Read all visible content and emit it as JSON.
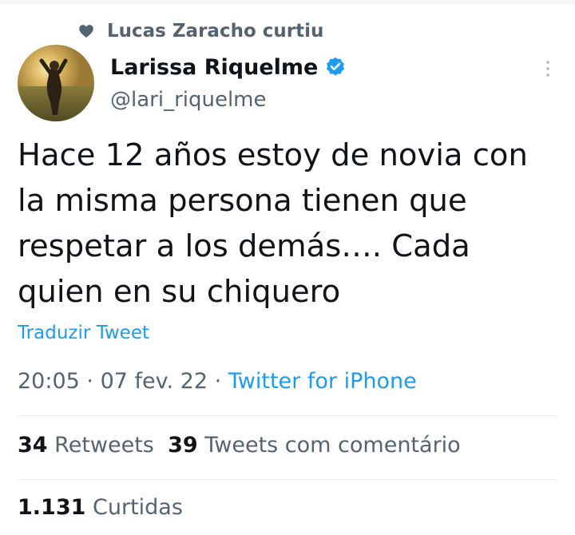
{
  "social_context": {
    "icon": "heart-icon",
    "text": "Lucas Zaracho curtiu"
  },
  "author": {
    "name": "Larissa Riquelme",
    "handle": "@lari_riquelme",
    "verified": true,
    "verified_color": "#1d9bf0"
  },
  "tweet": {
    "lines": [
      "Hace 12 años estoy de novia con",
      "la misma persona tienen que",
      "respetar a los demás…. Cada",
      "quien en su chiquero"
    ],
    "translate_label": "Traduzir Tweet"
  },
  "meta": {
    "time": "20:05",
    "separator": " · ",
    "date": "07 fev. 22",
    "source": "Twitter for iPhone"
  },
  "stats": {
    "retweets_count": "34",
    "retweets_label": "Retweets",
    "quotes_count": "39",
    "quotes_label": "Tweets com comentário",
    "likes_count": "1.131",
    "likes_label": "Curtidas"
  },
  "colors": {
    "accent": "#1d9bf0",
    "secondary_text": "#536471",
    "primary_text": "#0f1419"
  }
}
